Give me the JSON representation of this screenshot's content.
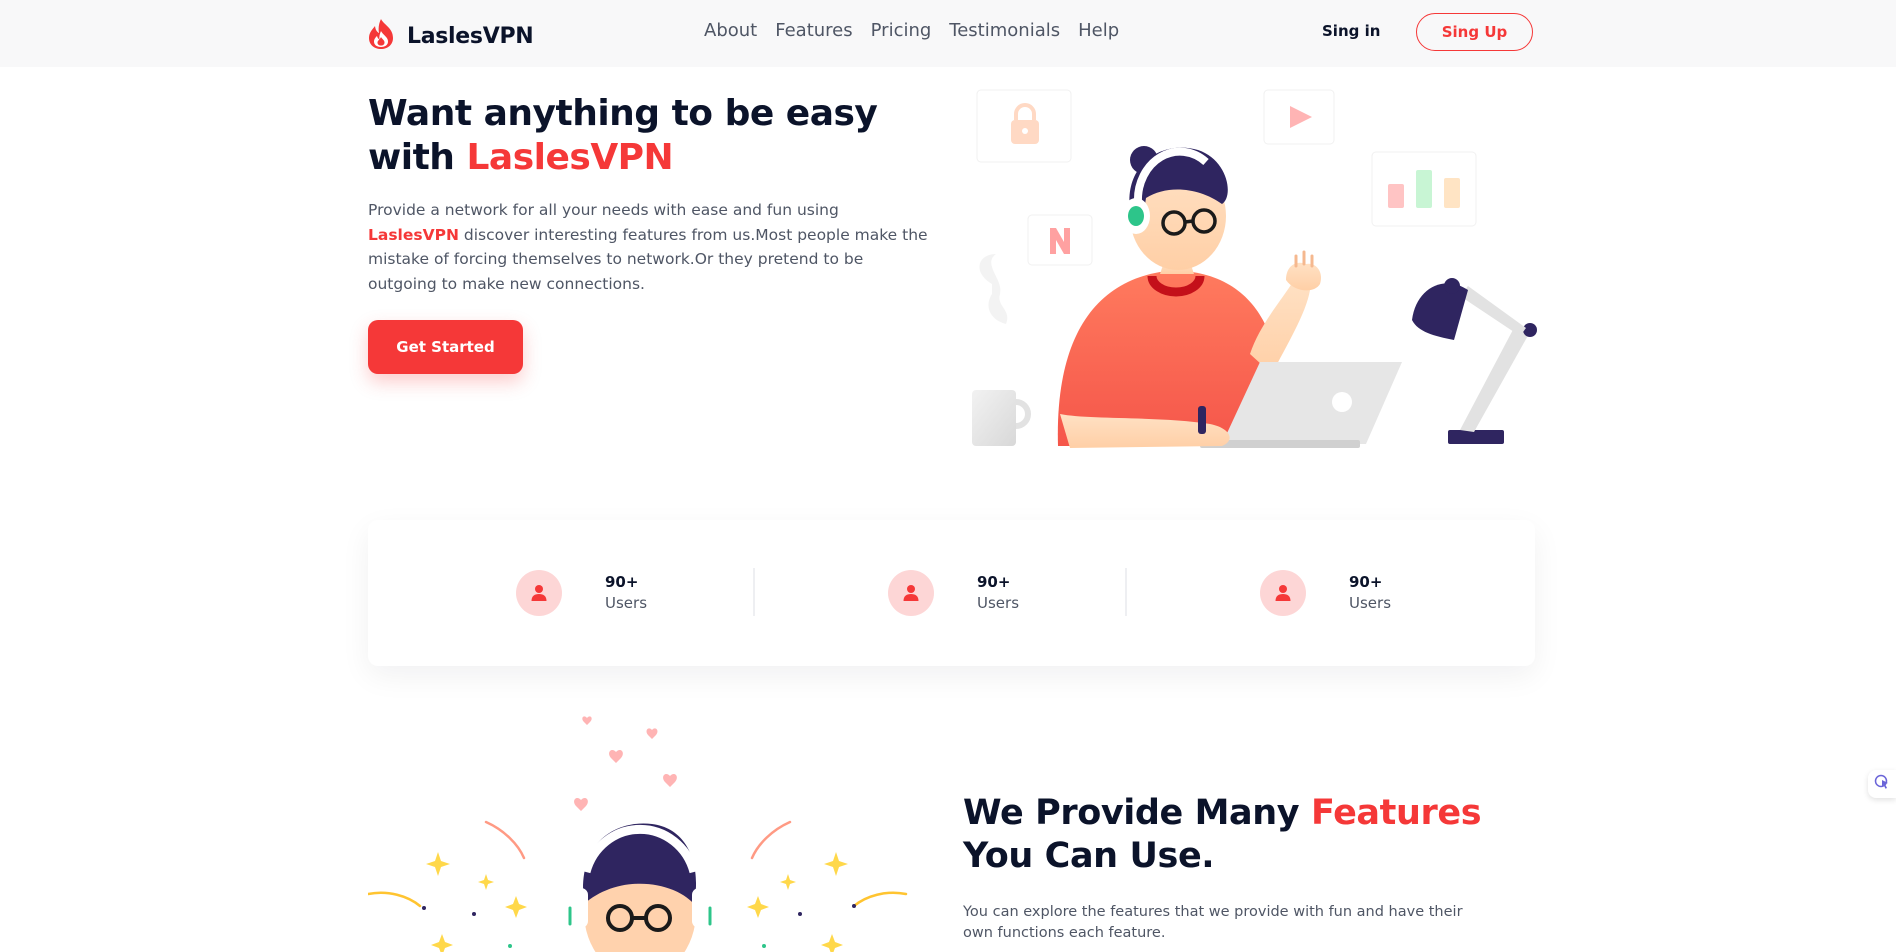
{
  "brand": {
    "name": "LaslesVPN"
  },
  "nav": {
    "links": [
      "About",
      "Features",
      "Pricing",
      "Testimonials",
      "Help"
    ],
    "signin_label": "Sing in",
    "signup_label": "Sing Up"
  },
  "hero": {
    "title_prefix": "Want anything to be easy with ",
    "title_accent": "LaslesVPN",
    "desc_prefix": "Provide a network for all your needs with ease and fun using ",
    "desc_brand": "LaslesVPN",
    "desc_suffix": " discover interesting features from us.Most people make the mistake of forcing themselves to network.Or they pretend to be outgoing to make new connections.",
    "cta_label": "Get Started"
  },
  "stats": [
    {
      "value": "90+",
      "label": "Users",
      "icon": "user-icon"
    },
    {
      "value": "90+",
      "label": "Users",
      "icon": "user-icon"
    },
    {
      "value": "90+",
      "label": "Users",
      "icon": "user-icon"
    }
  ],
  "features": {
    "title_prefix": "We Provide Many ",
    "title_accent": "Features",
    "title_suffix": " You Can Use.",
    "description": "You can explore the features that we provide with fun and have their own functions each feature."
  },
  "colors": {
    "accent": "#f53838",
    "text_dark": "#0b132a",
    "text_muted": "#4f5665",
    "nav_bg": "#f8f8f9",
    "icon_bg": "#fdd6d6",
    "illus_navy": "#2f2560",
    "illus_coral": "#ff7a5e"
  }
}
